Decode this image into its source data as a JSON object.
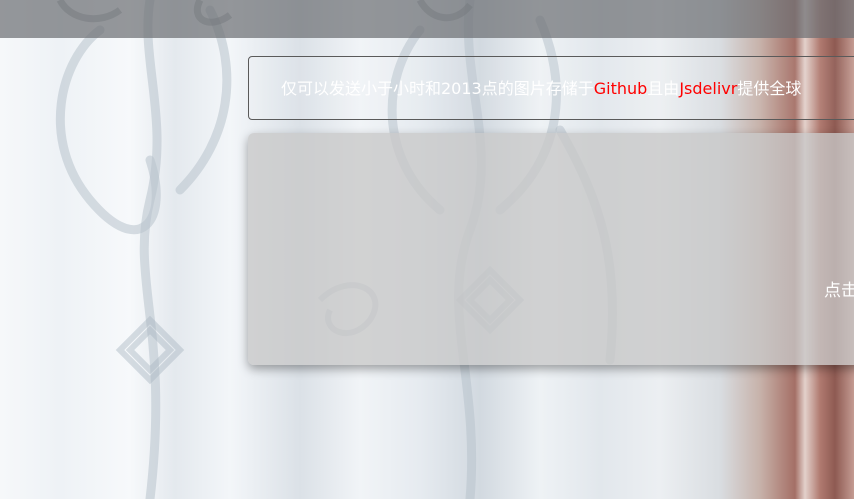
{
  "notice": {
    "text_prefix": "仅可以发送小于小时和2013点的图片存储于",
    "highlight_1": "Github",
    "text_mid": "且由",
    "highlight_2": "Jsdelivr",
    "text_suffix": "提供全球"
  },
  "card": {
    "link_label": "点击"
  },
  "colors": {
    "highlight": "#ff0000",
    "topbar": "#6e7074",
    "card_bg": "#c8c8c8"
  }
}
